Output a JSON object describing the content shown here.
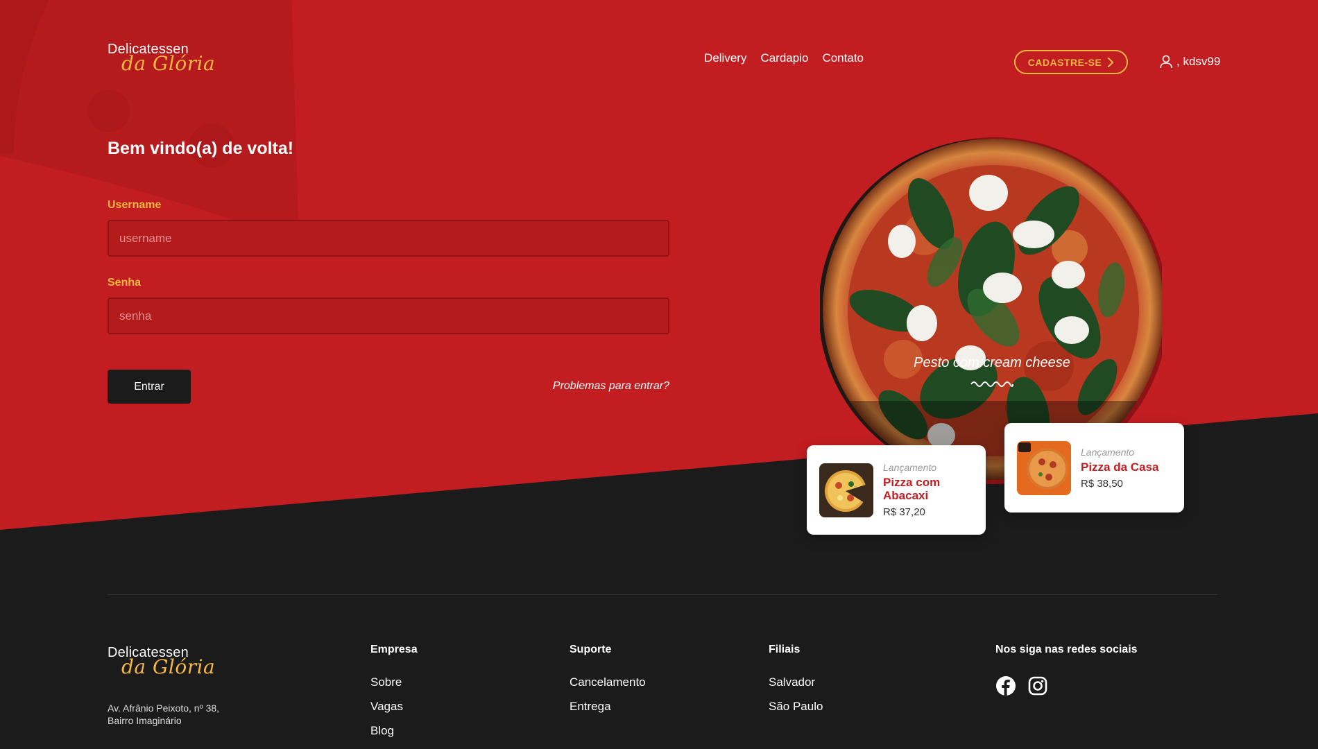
{
  "brand": {
    "line1": "Delicatessen",
    "line2": "da Glória"
  },
  "nav": {
    "links": [
      "Delivery",
      "Cardapio",
      "Contato"
    ],
    "cta": "CADASTRE-SE",
    "user": ", kdsv99"
  },
  "login": {
    "title": "Bem vindo(a) de volta!",
    "username_label": "Username",
    "username_placeholder": "username",
    "password_label": "Senha",
    "password_placeholder": "senha",
    "submit": "Entrar",
    "forgot": "Problemas para entrar?"
  },
  "hero": {
    "caption": "Pesto com cream cheese"
  },
  "cards": [
    {
      "tag": "Lançamento",
      "name": "Pizza com Abacaxi",
      "price": "R$ 37,20"
    },
    {
      "tag": "Lançamento",
      "name": "Pizza da Casa",
      "price": "R$ 38,50"
    }
  ],
  "footer": {
    "address": "Av. Afrânio Peixoto, nº 38, Bairro Imaginário",
    "columns": [
      {
        "title": "Empresa",
        "links": [
          "Sobre",
          "Vagas",
          "Blog"
        ]
      },
      {
        "title": "Suporte",
        "links": [
          "Cancelamento",
          "Entrega"
        ]
      },
      {
        "title": "Filiais",
        "links": [
          "Salvador",
          "São Paulo"
        ]
      }
    ],
    "social_title": "Nos siga nas redes sociais",
    "social_icons": [
      "facebook-icon",
      "instagram-icon"
    ]
  },
  "colors": {
    "primary_red": "#c21d20",
    "accent_yellow": "#f5b942",
    "dark": "#1b1b1b"
  }
}
